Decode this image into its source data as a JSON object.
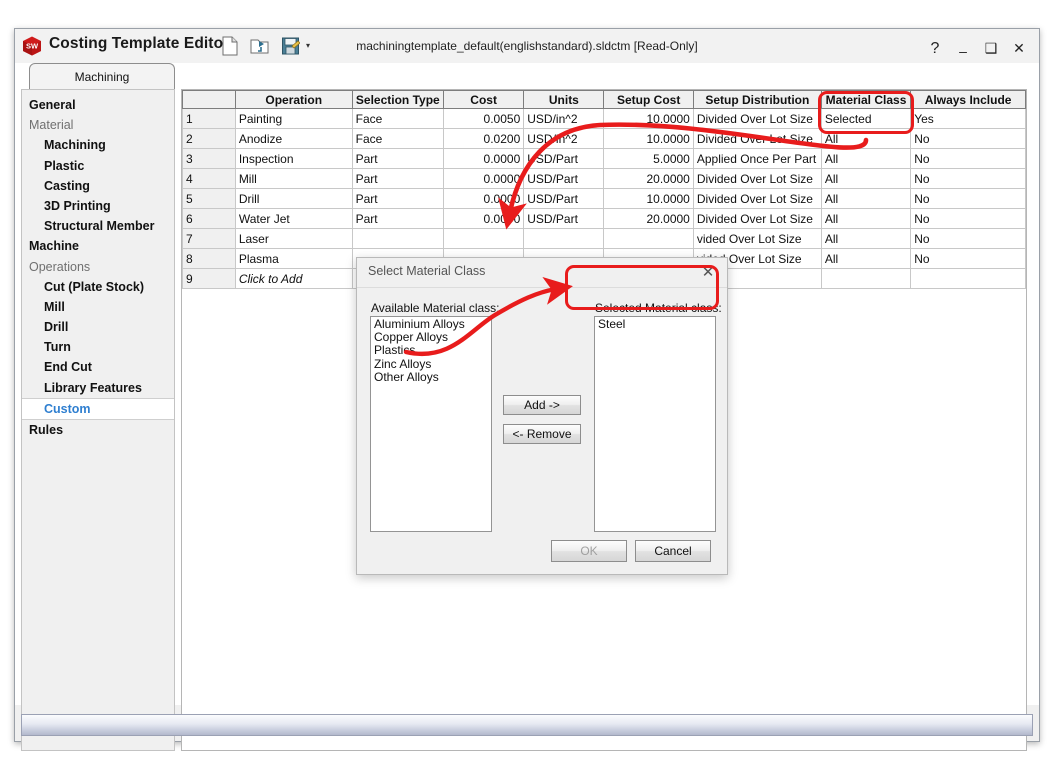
{
  "window": {
    "app_title": "Costing Template Editor",
    "document_title": "machiningtemplate_default(englishstandard).sldctm [Read-Only]",
    "logo_text": "SW",
    "controls": {
      "help": "?",
      "minimize": "–",
      "maximize": "❑",
      "close": "✕"
    },
    "toolbar": [
      {
        "name": "new-document-icon",
        "label": "New"
      },
      {
        "name": "open-folder-icon",
        "label": "Open"
      },
      {
        "name": "save-icon",
        "label": "Save"
      }
    ],
    "toolbar_dropdown_caret": "▾"
  },
  "tabs": [
    {
      "label": "Machining",
      "active": true
    }
  ],
  "sidebar": {
    "items": [
      {
        "label": "General",
        "type": "item"
      },
      {
        "label": "Material",
        "type": "header"
      },
      {
        "label": "Machining",
        "type": "indent"
      },
      {
        "label": "Plastic",
        "type": "indent"
      },
      {
        "label": "Casting",
        "type": "indent"
      },
      {
        "label": "3D Printing",
        "type": "indent"
      },
      {
        "label": "Structural Member",
        "type": "indent"
      },
      {
        "label": "Machine",
        "type": "item"
      },
      {
        "label": "Operations",
        "type": "header"
      },
      {
        "label": "Cut (Plate Stock)",
        "type": "indent"
      },
      {
        "label": "Mill",
        "type": "indent"
      },
      {
        "label": "Drill",
        "type": "indent"
      },
      {
        "label": "Turn",
        "type": "indent"
      },
      {
        "label": "End Cut",
        "type": "indent"
      },
      {
        "label": "Library Features",
        "type": "indent"
      },
      {
        "label": "Custom",
        "type": "indent",
        "selected": true
      },
      {
        "label": "Rules",
        "type": "item"
      }
    ]
  },
  "table": {
    "columns": [
      "",
      "Operation",
      "Selection Type",
      "Cost",
      "Units",
      "Setup Cost",
      "Setup Distribution",
      "Material Class",
      "Always Include"
    ],
    "rows": [
      {
        "n": "1",
        "operation": "Painting",
        "selection_type": "Face",
        "cost": "0.0050",
        "units": "USD/in^2",
        "setup_cost": "10.0000",
        "setup_distribution": "Divided Over Lot Size",
        "material_class": "Selected",
        "always_include": "Yes"
      },
      {
        "n": "2",
        "operation": "Anodize",
        "selection_type": "Face",
        "cost": "0.0200",
        "units": "USD/in^2",
        "setup_cost": "10.0000",
        "setup_distribution": "Divided Over Lot Size",
        "material_class": "All",
        "always_include": "No"
      },
      {
        "n": "3",
        "operation": "Inspection",
        "selection_type": "Part",
        "cost": "0.0000",
        "units": "USD/Part",
        "setup_cost": "5.0000",
        "setup_distribution": "Applied Once Per Part",
        "material_class": "All",
        "always_include": "No"
      },
      {
        "n": "4",
        "operation": "Mill",
        "selection_type": "Part",
        "cost": "0.0000",
        "units": "USD/Part",
        "setup_cost": "20.0000",
        "setup_distribution": "Divided Over Lot Size",
        "material_class": "All",
        "always_include": "No"
      },
      {
        "n": "5",
        "operation": "Drill",
        "selection_type": "Part",
        "cost": "0.0000",
        "units": "USD/Part",
        "setup_cost": "10.0000",
        "setup_distribution": "Divided Over Lot Size",
        "material_class": "All",
        "always_include": "No"
      },
      {
        "n": "6",
        "operation": "Water Jet",
        "selection_type": "Part",
        "cost": "0.0000",
        "units": "USD/Part",
        "setup_cost": "20.0000",
        "setup_distribution": "Divided Over Lot Size",
        "material_class": "All",
        "always_include": "No"
      },
      {
        "n": "7",
        "operation": "Laser",
        "selection_type": "",
        "cost": "",
        "units": "",
        "setup_cost": "",
        "setup_distribution": "vided Over Lot Size",
        "material_class": "All",
        "always_include": "No"
      },
      {
        "n": "8",
        "operation": "Plasma",
        "selection_type": "",
        "cost": "",
        "units": "",
        "setup_cost": "",
        "setup_distribution": "vided Over Lot Size",
        "material_class": "All",
        "always_include": "No"
      },
      {
        "n": "9",
        "operation": "Click to Add",
        "selection_type": "",
        "cost": "",
        "units": "",
        "setup_cost": "",
        "setup_distribution": "",
        "material_class": "",
        "always_include": ""
      }
    ]
  },
  "dialog": {
    "title": "Select Material Class",
    "close_label": "✕",
    "available_label": "Available Material class:",
    "available_items": [
      "Aluminium Alloys",
      "Copper Alloys",
      "Plastics",
      "Zinc Alloys",
      "Other Alloys"
    ],
    "selected_label": "Selected Material class:",
    "selected_items": [
      "Steel"
    ],
    "add_button": "Add ->",
    "remove_button": "<- Remove",
    "ok_button": "OK",
    "cancel_button": "Cancel"
  },
  "annotations": {
    "highlight_color": "#e81c1c",
    "boxes": [
      {
        "name": "material-class-highlight"
      },
      {
        "name": "selected-material-class-highlight"
      }
    ],
    "arrows": [
      {
        "name": "material-class-to-cost-arrow"
      },
      {
        "name": "available-to-selected-arrow"
      }
    ]
  }
}
